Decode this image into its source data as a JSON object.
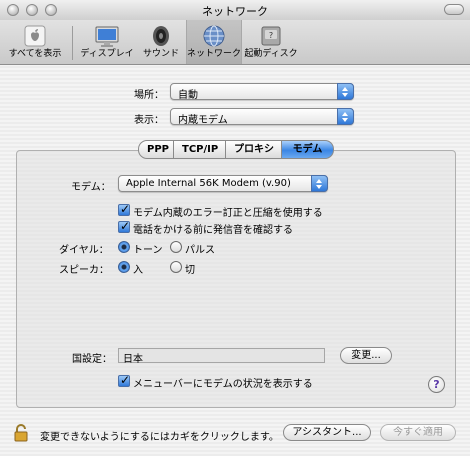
{
  "window": {
    "title": "ネットワーク"
  },
  "toolbar": {
    "items": [
      {
        "label": "すべてを表示",
        "icon": "show-all-icon"
      },
      {
        "label": "ディスプレイ",
        "icon": "display-icon"
      },
      {
        "label": "サウンド",
        "icon": "sound-icon"
      },
      {
        "label": "ネットワーク",
        "icon": "network-icon",
        "selected": true
      },
      {
        "label": "起動ディスク",
        "icon": "startup-disk-icon"
      }
    ]
  },
  "location": {
    "label": "場所：",
    "value": "自動"
  },
  "show": {
    "label": "表示：",
    "value": "内蔵モデム"
  },
  "tabs": [
    {
      "label": "PPP"
    },
    {
      "label": "TCP/IP"
    },
    {
      "label": "プロキシ"
    },
    {
      "label": "モデム",
      "active": true
    }
  ],
  "modem": {
    "label": "モデム：",
    "value": "Apple Internal 56K Modem (v.90)",
    "error_correction": {
      "label": "モデム内蔵のエラー訂正と圧縮を使用する",
      "checked": true
    },
    "dial_tone": {
      "label": "電話をかける前に発信音を確認する",
      "checked": true
    },
    "dialing": {
      "label": "ダイヤル：",
      "options": [
        "トーン",
        "パルス"
      ],
      "selected": "トーン"
    },
    "speaker": {
      "label": "スピーカ：",
      "options": [
        "入",
        "切"
      ],
      "selected": "入"
    }
  },
  "country": {
    "label": "国設定：",
    "value": "日本",
    "change_button": "変更..."
  },
  "menubar_status": {
    "label": "メニューバーにモデムの状況を表示する",
    "checked": true
  },
  "footer": {
    "lock_text": "変更できないようにするにはカギをクリックします。",
    "assistant_button": "アシスタント...",
    "apply_button": "今すぐ適用"
  },
  "colors": {
    "accent": "#3b86e4"
  }
}
